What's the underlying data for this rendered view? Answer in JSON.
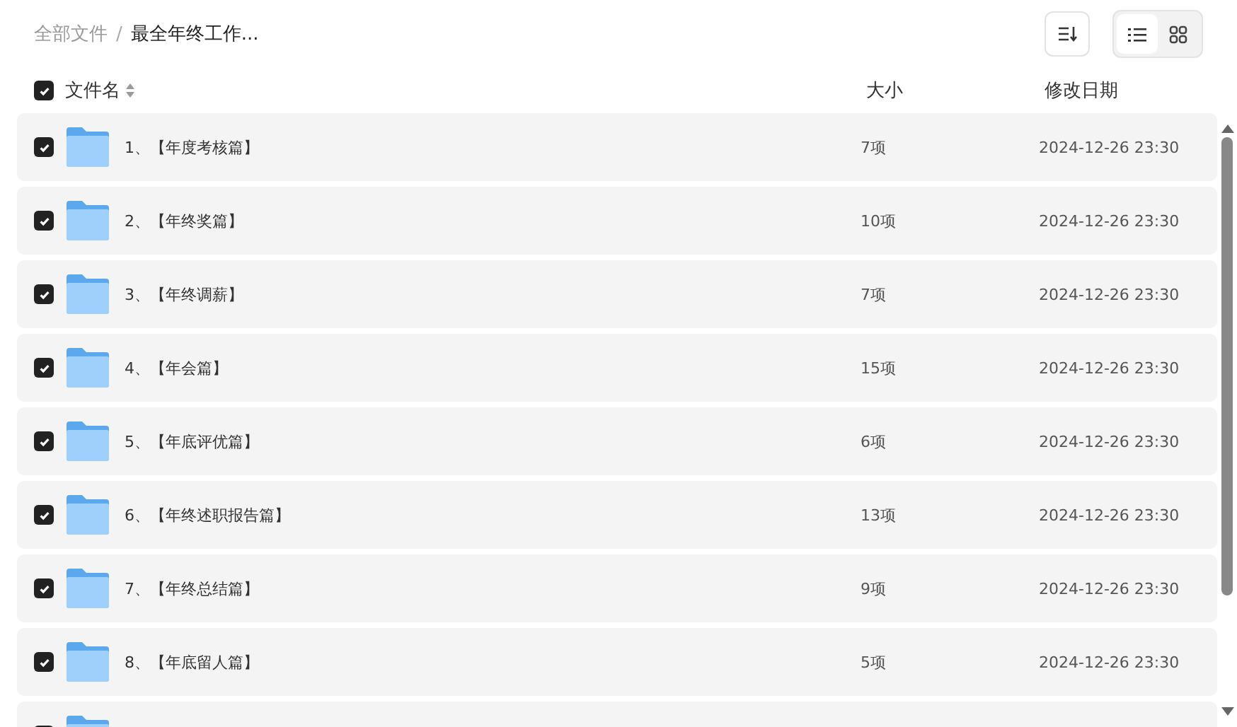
{
  "breadcrumb": [
    {
      "label": "全部文件",
      "current": false
    },
    {
      "label": "最全年终工作...",
      "current": true
    }
  ],
  "breadcrumb_separator": "/",
  "view_modes": [
    {
      "kind": "list",
      "selected": true
    },
    {
      "kind": "grid",
      "selected": false
    }
  ],
  "table": {
    "all_checked": true,
    "columns": [
      "文件名",
      "大小",
      "修改日期"
    ],
    "rows": [
      {
        "checked": true,
        "name": "1、【年度考核篇】",
        "size": "7项",
        "modified": "2024-12-26 23:30"
      },
      {
        "checked": true,
        "name": "2、【年终奖篇】",
        "size": "10项",
        "modified": "2024-12-26 23:30"
      },
      {
        "checked": true,
        "name": "3、【年终调薪】",
        "size": "7项",
        "modified": "2024-12-26 23:30"
      },
      {
        "checked": true,
        "name": "4、【年会篇】",
        "size": "15项",
        "modified": "2024-12-26 23:30"
      },
      {
        "checked": true,
        "name": "5、【年底评优篇】",
        "size": "6项",
        "modified": "2024-12-26 23:30"
      },
      {
        "checked": true,
        "name": "6、【年终述职报告篇】",
        "size": "13项",
        "modified": "2024-12-26 23:30"
      },
      {
        "checked": true,
        "name": "7、【年终总结篇】",
        "size": "9项",
        "modified": "2024-12-26 23:30"
      },
      {
        "checked": true,
        "name": "8、【年底留人篇】",
        "size": "5项",
        "modified": "2024-12-26 23:30"
      },
      {
        "checked": true
      }
    ]
  }
}
